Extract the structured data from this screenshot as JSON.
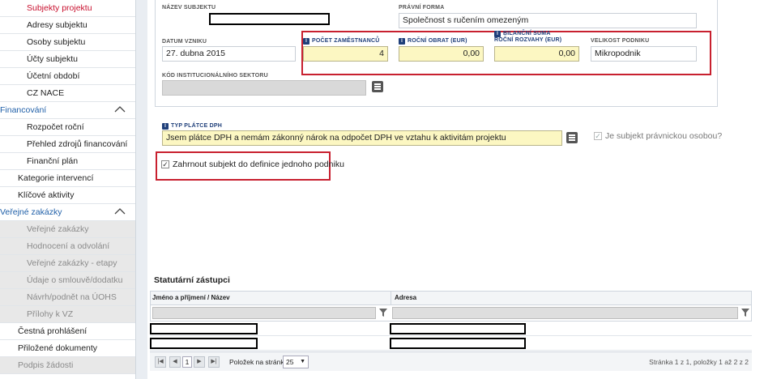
{
  "sidebar": {
    "items": [
      {
        "label": "Subjekty projektu",
        "kind": "sub",
        "state": "active"
      },
      {
        "label": "Adresy subjektu",
        "kind": "sub"
      },
      {
        "label": "Osoby subjektu",
        "kind": "sub"
      },
      {
        "label": "Účty subjektu",
        "kind": "sub"
      },
      {
        "label": "Účetní období",
        "kind": "sub"
      },
      {
        "label": "CZ NACE",
        "kind": "sub"
      },
      {
        "label": "Financování",
        "kind": "section"
      },
      {
        "label": "Rozpočet roční",
        "kind": "sub"
      },
      {
        "label": "Přehled zdrojů financování",
        "kind": "sub"
      },
      {
        "label": "Finanční plán",
        "kind": "sub"
      },
      {
        "label": "Kategorie intervencí",
        "kind": "top"
      },
      {
        "label": "Klíčové aktivity",
        "kind": "top"
      },
      {
        "label": "Veřejné zakázky",
        "kind": "section"
      },
      {
        "label": "Veřejné zakázky",
        "kind": "sub",
        "state": "disabled"
      },
      {
        "label": "Hodnocení a odvolání",
        "kind": "sub",
        "state": "disabled"
      },
      {
        "label": "Veřejné zakázky - etapy",
        "kind": "sub",
        "state": "disabled"
      },
      {
        "label": "Údaje o smlouvě/dodatku",
        "kind": "sub",
        "state": "disabled"
      },
      {
        "label": "Návrh/podnět na ÚOHS",
        "kind": "sub",
        "state": "disabled"
      },
      {
        "label": "Přílohy k VZ",
        "kind": "sub",
        "state": "disabled"
      },
      {
        "label": "Čestná prohlášení",
        "kind": "top"
      },
      {
        "label": "Přiložené dokumenty",
        "kind": "top"
      },
      {
        "label": "Podpis žádosti",
        "kind": "top",
        "state": "disabled"
      }
    ]
  },
  "form": {
    "nazev_label": "NÁZEV SUBJEKTU",
    "pravni_forma_label": "PRÁVNÍ FORMA",
    "pravni_forma_value": "Společnost s ručením omezeným",
    "datum_label": "DATUM VZNIKU",
    "datum_value": "27. dubna 2015",
    "pocet_label": "POČET ZAMĚSTNANCŮ",
    "pocet_value": "4",
    "obrat_label": "ROČNÍ OBRAT (EUR)",
    "obrat_value": "0,00",
    "bilancni_label1": "BILANČNÍ SUMA",
    "bilancni_label2": "ROČNÍ ROZVAHY (EUR)",
    "bilancni_value": "0,00",
    "velikost_label": "VELIKOST PODNIKU",
    "velikost_value": "Mikropodnik",
    "kod_label": "KÓD INSTITUCIONÁLNÍHO SEKTORU",
    "typ_dph_label": "TYP PLÁTCE DPH",
    "typ_dph_value": "Jsem plátce DPH a nemám zákonný nárok na odpočet DPH ve vztahu k aktivitám projektu",
    "pravnicka_label": "Je subjekt právnickou osobou?",
    "zahrnout_label": "Zahrnout subjekt do definice jednoho podniku"
  },
  "table": {
    "title": "Statutární zástupci",
    "columns": [
      "Jméno a příjmení / Název",
      "Adresa"
    ],
    "pager": {
      "current_page": "1",
      "page_size_label": "Položek na stránku",
      "page_size": "25",
      "summary": "Stránka 1 z 1, položky 1 až 2 z 2"
    }
  },
  "icons": {
    "info": "i",
    "chevron": "chevron-up-icon",
    "list": "list-icon",
    "filter": "funnel-icon"
  },
  "colors": {
    "active_nav": "#c8102e",
    "section_nav": "#1f5fa8",
    "highlight_box": "#c8202f",
    "required_field": "#fcf7c2"
  }
}
